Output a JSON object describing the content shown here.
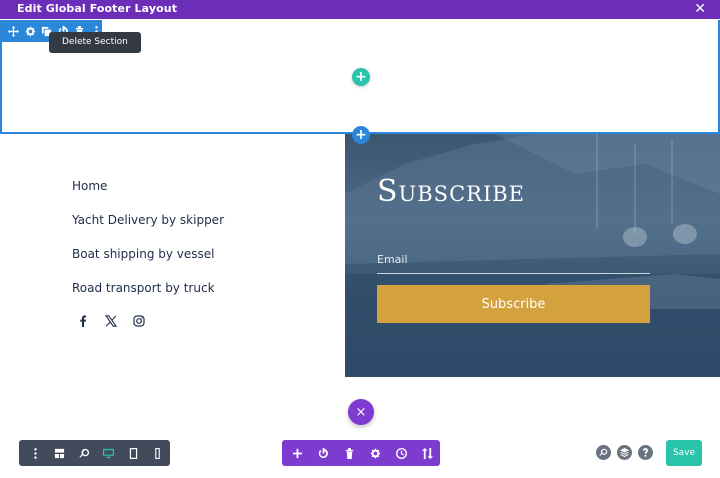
{
  "window": {
    "title": "Edit Global Footer Layout",
    "close_icon": "close-icon",
    "accent_color": "#6c2eb9"
  },
  "section_toolbar": {
    "items": [
      "move-icon",
      "gear-icon",
      "duplicate-icon",
      "power-icon",
      "trash-icon",
      "more-icon"
    ],
    "tooltip": "Delete Section",
    "color": "#2b87da"
  },
  "builder": {
    "add_row_icon": "+",
    "add_section_icon": "+",
    "add_row_color": "#29c4a9"
  },
  "footer": {
    "nav": [
      "Home",
      "Yacht Delivery by skipper",
      "Boat shipping by vessel",
      "Road transport by truck"
    ],
    "socials": [
      "facebook-icon",
      "x-icon",
      "instagram-icon"
    ]
  },
  "subscribe": {
    "title": "Subscribe",
    "email_placeholder": "Email",
    "button_label": "Subscribe",
    "button_color": "#d4a23c"
  },
  "fab": {
    "close_glyph": "×",
    "color": "#7e3bd0"
  },
  "bottom_left_toolbar": {
    "items": [
      "menu-dots-icon",
      "wireframe-icon",
      "zoom-icon",
      "desktop-icon",
      "tablet-icon",
      "phone-icon"
    ],
    "active": "desktop-icon"
  },
  "bottom_center_toolbar": {
    "items": [
      "add-icon",
      "power-icon",
      "trash-icon",
      "gear-icon",
      "history-icon",
      "portability-icon"
    ],
    "color": "#7e3bd0"
  },
  "bottom_right": {
    "items": [
      "search-icon",
      "layers-icon",
      "help-icon"
    ],
    "save_label": "Save",
    "save_color": "#29c4a9"
  }
}
